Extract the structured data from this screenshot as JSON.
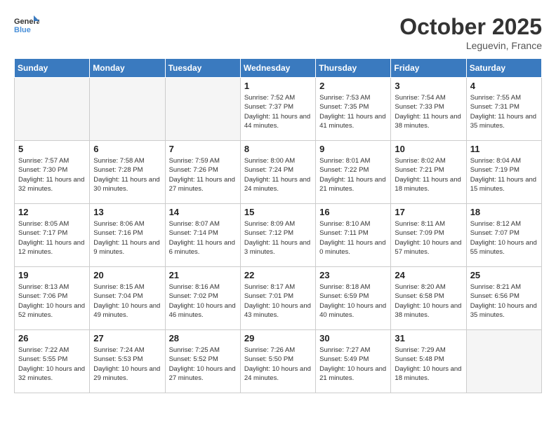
{
  "header": {
    "logo_line1": "General",
    "logo_line2": "Blue",
    "month": "October 2025",
    "location": "Leguevin, France"
  },
  "days_of_week": [
    "Sunday",
    "Monday",
    "Tuesday",
    "Wednesday",
    "Thursday",
    "Friday",
    "Saturday"
  ],
  "weeks": [
    [
      {
        "day": "",
        "empty": true
      },
      {
        "day": "",
        "empty": true
      },
      {
        "day": "",
        "empty": true
      },
      {
        "day": "1",
        "sunrise": "7:52 AM",
        "sunset": "7:37 PM",
        "daylight": "11 hours and 44 minutes."
      },
      {
        "day": "2",
        "sunrise": "7:53 AM",
        "sunset": "7:35 PM",
        "daylight": "11 hours and 41 minutes."
      },
      {
        "day": "3",
        "sunrise": "7:54 AM",
        "sunset": "7:33 PM",
        "daylight": "11 hours and 38 minutes."
      },
      {
        "day": "4",
        "sunrise": "7:55 AM",
        "sunset": "7:31 PM",
        "daylight": "11 hours and 35 minutes."
      }
    ],
    [
      {
        "day": "5",
        "sunrise": "7:57 AM",
        "sunset": "7:30 PM",
        "daylight": "11 hours and 32 minutes."
      },
      {
        "day": "6",
        "sunrise": "7:58 AM",
        "sunset": "7:28 PM",
        "daylight": "11 hours and 30 minutes."
      },
      {
        "day": "7",
        "sunrise": "7:59 AM",
        "sunset": "7:26 PM",
        "daylight": "11 hours and 27 minutes."
      },
      {
        "day": "8",
        "sunrise": "8:00 AM",
        "sunset": "7:24 PM",
        "daylight": "11 hours and 24 minutes."
      },
      {
        "day": "9",
        "sunrise": "8:01 AM",
        "sunset": "7:22 PM",
        "daylight": "11 hours and 21 minutes."
      },
      {
        "day": "10",
        "sunrise": "8:02 AM",
        "sunset": "7:21 PM",
        "daylight": "11 hours and 18 minutes."
      },
      {
        "day": "11",
        "sunrise": "8:04 AM",
        "sunset": "7:19 PM",
        "daylight": "11 hours and 15 minutes."
      }
    ],
    [
      {
        "day": "12",
        "sunrise": "8:05 AM",
        "sunset": "7:17 PM",
        "daylight": "11 hours and 12 minutes."
      },
      {
        "day": "13",
        "sunrise": "8:06 AM",
        "sunset": "7:16 PM",
        "daylight": "11 hours and 9 minutes."
      },
      {
        "day": "14",
        "sunrise": "8:07 AM",
        "sunset": "7:14 PM",
        "daylight": "11 hours and 6 minutes."
      },
      {
        "day": "15",
        "sunrise": "8:09 AM",
        "sunset": "7:12 PM",
        "daylight": "11 hours and 3 minutes."
      },
      {
        "day": "16",
        "sunrise": "8:10 AM",
        "sunset": "7:11 PM",
        "daylight": "11 hours and 0 minutes."
      },
      {
        "day": "17",
        "sunrise": "8:11 AM",
        "sunset": "7:09 PM",
        "daylight": "10 hours and 57 minutes."
      },
      {
        "day": "18",
        "sunrise": "8:12 AM",
        "sunset": "7:07 PM",
        "daylight": "10 hours and 55 minutes."
      }
    ],
    [
      {
        "day": "19",
        "sunrise": "8:13 AM",
        "sunset": "7:06 PM",
        "daylight": "10 hours and 52 minutes."
      },
      {
        "day": "20",
        "sunrise": "8:15 AM",
        "sunset": "7:04 PM",
        "daylight": "10 hours and 49 minutes."
      },
      {
        "day": "21",
        "sunrise": "8:16 AM",
        "sunset": "7:02 PM",
        "daylight": "10 hours and 46 minutes."
      },
      {
        "day": "22",
        "sunrise": "8:17 AM",
        "sunset": "7:01 PM",
        "daylight": "10 hours and 43 minutes."
      },
      {
        "day": "23",
        "sunrise": "8:18 AM",
        "sunset": "6:59 PM",
        "daylight": "10 hours and 40 minutes."
      },
      {
        "day": "24",
        "sunrise": "8:20 AM",
        "sunset": "6:58 PM",
        "daylight": "10 hours and 38 minutes."
      },
      {
        "day": "25",
        "sunrise": "8:21 AM",
        "sunset": "6:56 PM",
        "daylight": "10 hours and 35 minutes."
      }
    ],
    [
      {
        "day": "26",
        "sunrise": "7:22 AM",
        "sunset": "5:55 PM",
        "daylight": "10 hours and 32 minutes."
      },
      {
        "day": "27",
        "sunrise": "7:24 AM",
        "sunset": "5:53 PM",
        "daylight": "10 hours and 29 minutes."
      },
      {
        "day": "28",
        "sunrise": "7:25 AM",
        "sunset": "5:52 PM",
        "daylight": "10 hours and 27 minutes."
      },
      {
        "day": "29",
        "sunrise": "7:26 AM",
        "sunset": "5:50 PM",
        "daylight": "10 hours and 24 minutes."
      },
      {
        "day": "30",
        "sunrise": "7:27 AM",
        "sunset": "5:49 PM",
        "daylight": "10 hours and 21 minutes."
      },
      {
        "day": "31",
        "sunrise": "7:29 AM",
        "sunset": "5:48 PM",
        "daylight": "10 hours and 18 minutes."
      },
      {
        "day": "",
        "empty": true
      }
    ]
  ]
}
